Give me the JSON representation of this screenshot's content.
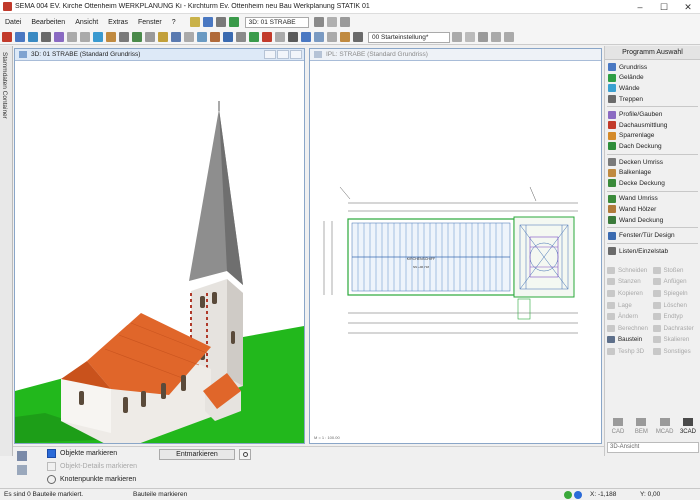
{
  "app": {
    "title": "SEMA  004 EV. Kirche Ottenheim WERKPLANUNG  Ki - Kirchturm Ev. Ottenheim neu Bau Werkplanung STATIK 01"
  },
  "menu": {
    "items": [
      "Datei",
      "Bearbeiten",
      "Ansicht",
      "Extras",
      "Fenster",
      "?"
    ],
    "view_select": "3D: 01  STRABE"
  },
  "toolbar": {
    "start_setting": "00 Starteinstellung*"
  },
  "left_sidebar": {
    "label": "Stammdaten Container"
  },
  "windows": {
    "view3d": {
      "title": "3D: 01  STRABE (Standard Grundriss)"
    },
    "plan": {
      "title": "IPL: STRABE (Standard Grundriss)",
      "scale_note": "M = 1 : 100.00",
      "plan_label": "KIRCHENSCHIFF",
      "plan_sublabel": "NN +96.718"
    }
  },
  "right_panel": {
    "header": "Programm Auswahl",
    "groups": [
      [
        {
          "label": "Grundriss",
          "color": "#4a78c2"
        },
        {
          "label": "Gelände",
          "color": "#2e9e44"
        },
        {
          "label": "Wände",
          "color": "#3aa0d0"
        },
        {
          "label": "Treppen",
          "color": "#6a6a6a"
        }
      ],
      [
        {
          "label": "Profile/Gauben",
          "color": "#8a6ac2"
        },
        {
          "label": "Dachausmittlung",
          "color": "#c23a2a"
        },
        {
          "label": "Sparrenlage",
          "color": "#d48a2a"
        },
        {
          "label": "Dach Deckung",
          "color": "#2e8e3a"
        }
      ],
      [
        {
          "label": "Decken Umriss",
          "color": "#7a7a7a"
        },
        {
          "label": "Balkenlage",
          "color": "#c08a40"
        },
        {
          "label": "Decke Deckung",
          "color": "#3a8a3a"
        }
      ],
      [
        {
          "label": "Wand Umriss",
          "color": "#3a8a3a"
        },
        {
          "label": "Wand Hölzer",
          "color": "#b07a3a"
        },
        {
          "label": "Wand Deckung",
          "color": "#3a7a3a"
        }
      ],
      [
        {
          "label": "Fenster/Tür Design",
          "color": "#3a6ab0"
        }
      ],
      [
        {
          "label": "Listen/Einzelstab",
          "color": "#6a6a6a"
        }
      ]
    ],
    "tools": [
      {
        "label": "Schneiden",
        "on": false
      },
      {
        "label": "Stoßen",
        "on": false
      },
      {
        "label": "Stanzen",
        "on": false
      },
      {
        "label": "Anfügen",
        "on": false
      },
      {
        "label": "Kopieren",
        "on": false
      },
      {
        "label": "Spiegeln",
        "on": false
      },
      {
        "label": "Lage",
        "on": false
      },
      {
        "label": "Löschen",
        "on": false
      },
      {
        "label": "Ändern",
        "on": false
      },
      {
        "label": "Endtyp",
        "on": false
      },
      {
        "label": "Berechnen",
        "on": false
      },
      {
        "label": "Dachraster",
        "on": false
      },
      {
        "label": "Baustein",
        "on": true
      },
      {
        "label": "Skalieren",
        "on": false
      },
      {
        "label": "Teshp 3D",
        "on": false
      },
      {
        "label": "Sonstiges",
        "on": false
      }
    ],
    "modes": [
      "CAD",
      "BEM",
      "MCAD",
      "3CAD"
    ],
    "view_mode": "3D-Ansicht"
  },
  "bottom": {
    "mark_objects": "Objekte markieren",
    "mark_object_details": "Objekt-Details markieren",
    "mark_nodes": "Knotenpunkte markieren",
    "unmark": "Entmarkieren"
  },
  "status": {
    "left": "Es sind 0 Bauteile markiert.",
    "mid": "Bauteile markieren",
    "coord": "X: -1,188",
    "coord2": "Y: 0,00"
  }
}
